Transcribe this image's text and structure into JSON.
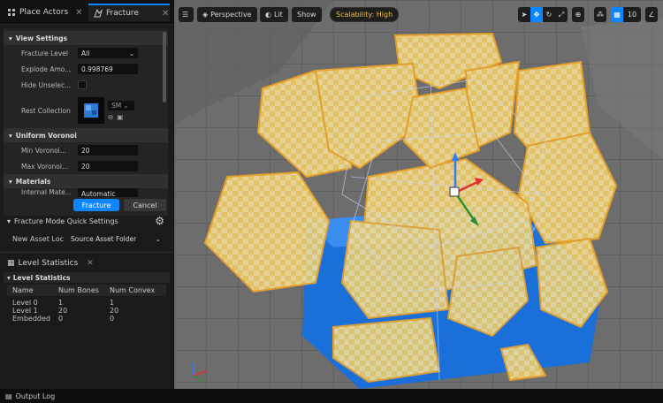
{
  "tabs": {
    "place_actors": "Place Actors",
    "fracture": "Fracture",
    "close": "✕"
  },
  "fracture_panel": {
    "view_settings": "View Settings",
    "fracture_level_label": "Fracture Level",
    "fracture_level_value": "All",
    "explode_label": "Explode Amo...",
    "explode_value": "0.998769",
    "hide_unselected_label": "Hide Unselec...",
    "rest_collection_label": "Rest Collection",
    "rest_collection_type": "SM",
    "uniform_voronoi": "Uniform Voronoi",
    "min_voronoi_label": "Min Voronoi...",
    "min_voronoi_value": "20",
    "max_voronoi_label": "Max Voronoi...",
    "max_voronoi_value": "20",
    "materials": "Materials",
    "internal_material_label": "Internal Mate...",
    "internal_material_value": "Automatic",
    "fracture_button": "Fracture",
    "cancel_button": "Cancel"
  },
  "quick_settings": {
    "title": "Fracture Mode Quick Settings",
    "new_asset_label": "New Asset Loc",
    "new_asset_value": "Source Asset Folder"
  },
  "level_statistics": {
    "tab": "Level Statistics",
    "section": "Level Statistics",
    "headers": [
      "Name",
      "Num Bones",
      "Num Convex"
    ],
    "rows": [
      [
        "Level 0",
        "1",
        "1"
      ],
      [
        "Level 1",
        "20",
        "20"
      ],
      [
        "Embedded",
        "0",
        "0"
      ]
    ]
  },
  "viewport": {
    "perspective": "Perspective",
    "lit": "Lit",
    "show": "Show",
    "scalability": "Scalability: High",
    "grid_value": "10"
  },
  "status_bar": {
    "output_log": "Output Log"
  },
  "colors": {
    "accent": "#0e86ff",
    "chunk_fill": "#f2c94c",
    "chunk_border": "#f5a623",
    "floor": "#6a6a6a",
    "cube": "#1b6fd8"
  }
}
